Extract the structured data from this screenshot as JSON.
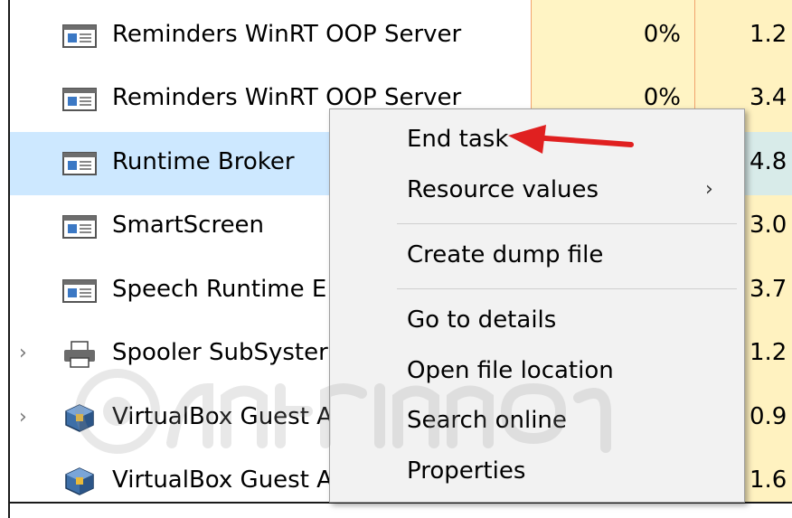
{
  "processes": [
    {
      "name": "Reminders WinRT OOP Server",
      "cpu": "0%",
      "memory": "1.2",
      "icon": "app-window-icon",
      "expandable": false
    },
    {
      "name": "Reminders WinRT OOP Server",
      "cpu": "0%",
      "memory": "3.4",
      "icon": "app-window-icon",
      "expandable": false
    },
    {
      "name": "Runtime Broker",
      "cpu": "",
      "memory": "4.8",
      "icon": "app-window-icon",
      "expandable": false,
      "selected": true
    },
    {
      "name": "SmartScreen",
      "cpu": "",
      "memory": "3.0",
      "icon": "app-window-icon",
      "expandable": false
    },
    {
      "name": "Speech Runtime E",
      "cpu": "",
      "memory": "3.7",
      "icon": "app-window-icon",
      "expandable": false
    },
    {
      "name": "Spooler SubSyster",
      "cpu": "",
      "memory": "1.2",
      "icon": "printer-icon",
      "expandable": true
    },
    {
      "name": "VirtualBox Guest A",
      "cpu": "",
      "memory": "0.9",
      "icon": "virtualbox-icon",
      "expandable": true
    },
    {
      "name": "VirtualBox Guest A",
      "cpu": "",
      "memory": "1.6",
      "icon": "virtualbox-icon",
      "expandable": false
    }
  ],
  "context_menu": {
    "items": [
      {
        "label": "End task"
      },
      {
        "label": "Resource values",
        "has_submenu": true
      },
      {
        "label": "Create dump file"
      },
      {
        "label": "Go to details"
      },
      {
        "label": "Open file location"
      },
      {
        "label": "Search online"
      },
      {
        "label": "Properties"
      }
    ]
  },
  "annotation": {
    "icon": "red-arrow-icon",
    "color": "#e02020"
  },
  "colors": {
    "selected_row": "#cde8ff",
    "cpu_column": "#fff4c4",
    "column_separator": "#f1a36d"
  }
}
